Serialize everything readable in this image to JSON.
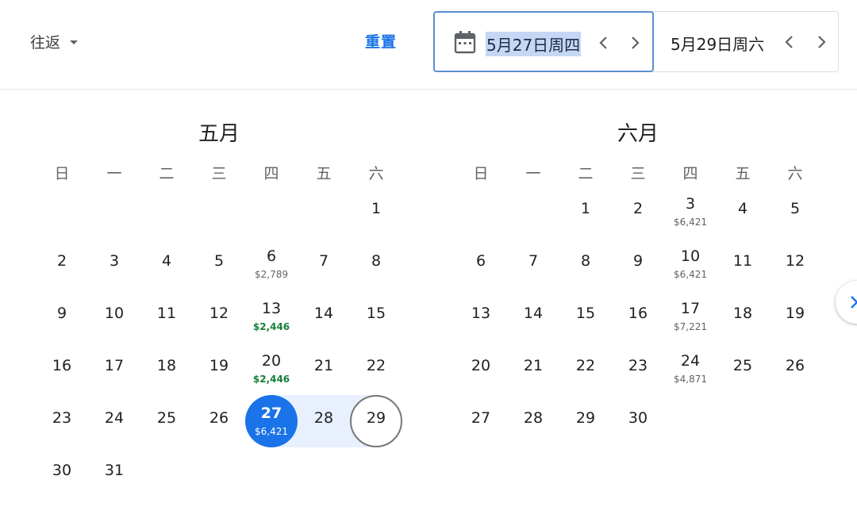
{
  "header": {
    "trip_type": "往返",
    "reset_label": "重置",
    "depart_date": "5月27日周四",
    "return_date": "5月29日周六"
  },
  "weekdays": [
    "日",
    "一",
    "二",
    "三",
    "四",
    "五",
    "六"
  ],
  "months": [
    {
      "title": "五月",
      "days": [
        {
          "d": "1"
        },
        {
          "d": "2"
        },
        {
          "d": "3"
        },
        {
          "d": "4"
        },
        {
          "d": "5"
        },
        {
          "d": "6",
          "p": "$2,789"
        },
        {
          "d": "7"
        },
        {
          "d": "8"
        },
        {
          "d": "9"
        },
        {
          "d": "10"
        },
        {
          "d": "11"
        },
        {
          "d": "12"
        },
        {
          "d": "13",
          "p": "$2,446",
          "green": true
        },
        {
          "d": "14"
        },
        {
          "d": "15"
        },
        {
          "d": "16"
        },
        {
          "d": "17"
        },
        {
          "d": "18"
        },
        {
          "d": "19"
        },
        {
          "d": "20",
          "p": "$2,446",
          "green": true
        },
        {
          "d": "21"
        },
        {
          "d": "22"
        },
        {
          "d": "23"
        },
        {
          "d": "24"
        },
        {
          "d": "25"
        },
        {
          "d": "26"
        },
        {
          "d": "27",
          "p": "$6,421",
          "state": "selected"
        },
        {
          "d": "28",
          "state": "range"
        },
        {
          "d": "29",
          "state": "ring"
        },
        {
          "d": "30"
        },
        {
          "d": "31"
        }
      ]
    },
    {
      "title": "六月",
      "days": [
        {
          "d": "1"
        },
        {
          "d": "2"
        },
        {
          "d": "3",
          "p": "$6,421"
        },
        {
          "d": "4"
        },
        {
          "d": "5"
        },
        {
          "d": "6"
        },
        {
          "d": "7"
        },
        {
          "d": "8"
        },
        {
          "d": "9"
        },
        {
          "d": "10",
          "p": "$6,421"
        },
        {
          "d": "11"
        },
        {
          "d": "12"
        },
        {
          "d": "13"
        },
        {
          "d": "14"
        },
        {
          "d": "15"
        },
        {
          "d": "16"
        },
        {
          "d": "17",
          "p": "$7,221"
        },
        {
          "d": "18"
        },
        {
          "d": "19"
        },
        {
          "d": "20"
        },
        {
          "d": "21"
        },
        {
          "d": "22"
        },
        {
          "d": "23"
        },
        {
          "d": "24",
          "p": "$4,871"
        },
        {
          "d": "25"
        },
        {
          "d": "26"
        },
        {
          "d": "27"
        },
        {
          "d": "28"
        },
        {
          "d": "29"
        },
        {
          "d": "30"
        }
      ]
    }
  ],
  "icons": {
    "calendar": "calendar-icon",
    "prev": "chevron-left-icon",
    "next": "chevron-right-icon",
    "dropdown": "caret-down-icon"
  },
  "colors": {
    "accent": "#1a73e8",
    "range": "#e8f0fe",
    "price_good": "#188038"
  }
}
